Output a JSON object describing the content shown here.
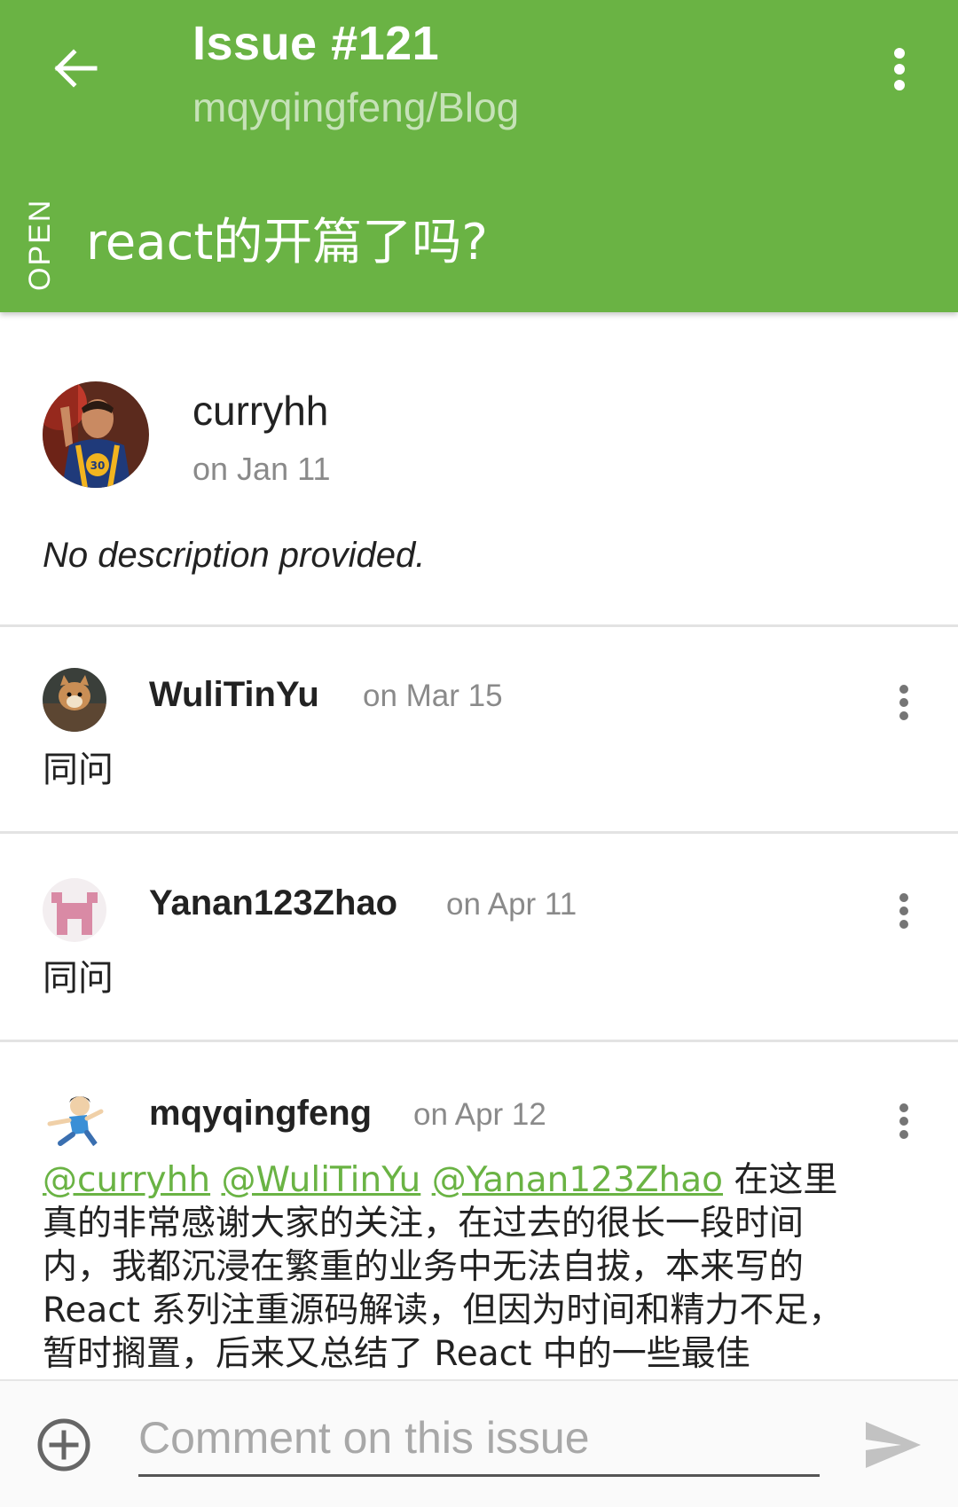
{
  "appbar": {
    "title": "Issue #121",
    "subtitle": "mqyqingfeng/Blog",
    "state": "OPEN",
    "issue_title": "react的开篇了吗?",
    "back_icon": "arrow-left-icon",
    "menu_icon": "more-vert-icon"
  },
  "issue": {
    "author": "curryhh",
    "date": "on Jan 11",
    "description": "No description provided."
  },
  "comments": [
    {
      "author": "WuliTinYu",
      "date": "on Mar 15",
      "body": "同问"
    },
    {
      "author": "Yanan123Zhao",
      "date": "on Apr 11",
      "body": "同问"
    },
    {
      "author": "mqyqingfeng",
      "date": "on Apr 12",
      "mentions": [
        "@curryhh",
        "@WuliTinYu",
        "@Yanan123Zhao"
      ],
      "body": "在这里真的非常感谢大家的关注，在过去的很长一段时间内，我都沉浸在繁重的业务中无法自拔，本来写的 React 系列注重源码解读，但因为时间和精力不足，暂时搁置，后来又总结了 React 中的一些最佳"
    }
  ],
  "composer": {
    "placeholder": "Comment on this issue",
    "add_icon": "add-circle-icon",
    "send_icon": "send-icon"
  },
  "colors": {
    "accent": "#6ab344",
    "text_primary": "#222222",
    "text_secondary": "#8a8a8a"
  }
}
